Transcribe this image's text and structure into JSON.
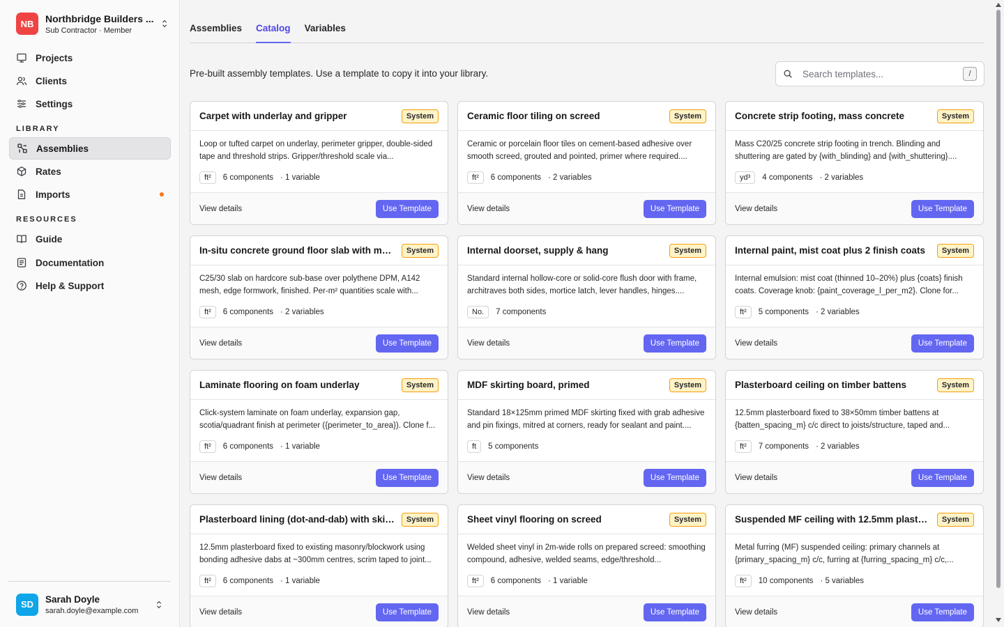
{
  "org": {
    "initials": "NB",
    "name": "Northbridge Builders ...",
    "role": "Sub Contractor · Member"
  },
  "nav": {
    "main": [
      {
        "label": "Projects",
        "icon": "projects-icon"
      },
      {
        "label": "Clients",
        "icon": "users-icon"
      },
      {
        "label": "Settings",
        "icon": "sliders-icon"
      }
    ],
    "library_label": "LIBRARY",
    "library": [
      {
        "label": "Assemblies",
        "icon": "assemblies-icon",
        "active": true
      },
      {
        "label": "Rates",
        "icon": "box-icon"
      },
      {
        "label": "Imports",
        "icon": "file-icon",
        "notification": true
      }
    ],
    "resources_label": "RESOURCES",
    "resources": [
      {
        "label": "Guide",
        "icon": "book-icon"
      },
      {
        "label": "Documentation",
        "icon": "document-icon"
      },
      {
        "label": "Help & Support",
        "icon": "help-icon"
      }
    ]
  },
  "user": {
    "initials": "SD",
    "name": "Sarah Doyle",
    "email": "sarah.doyle@example.com"
  },
  "tabs": [
    {
      "label": "Assemblies",
      "active": false
    },
    {
      "label": "Catalog",
      "active": true
    },
    {
      "label": "Variables",
      "active": false
    }
  ],
  "intro": "Pre-built assembly templates. Use a template to copy it into your library.",
  "search": {
    "placeholder": "Search templates...",
    "shortcut": "/"
  },
  "card_labels": {
    "badge": "System",
    "view": "View details",
    "use": "Use Template"
  },
  "templates": [
    {
      "title": "Carpet with underlay and gripper",
      "desc": "Loop or tufted carpet on underlay, perimeter gripper, double-sided tape and threshold strips. Gripper/threshold scale via...",
      "unit": "ft²",
      "components": "6 components",
      "variables": "· 1 variable"
    },
    {
      "title": "Ceramic floor tiling on screed",
      "desc": "Ceramic or porcelain floor tiles on cement-based adhesive over smooth screed, grouted and pointed, primer where required....",
      "unit": "ft²",
      "components": "6 components",
      "variables": "· 2 variables"
    },
    {
      "title": "Concrete strip footing, mass concrete",
      "desc": "Mass C20/25 concrete strip footing in trench. Blinding and shuttering are gated by {with_blinding} and {with_shuttering}....",
      "unit": "yd³",
      "components": "4 components",
      "variables": "· 2 variables"
    },
    {
      "title": "In-situ concrete ground floor slab with mesh",
      "desc": "C25/30 slab on hardcore sub-base over polythene DPM, A142 mesh, edge formwork, finished. Per-m² quantities scale with...",
      "unit": "ft²",
      "components": "6 components",
      "variables": "· 2 variables"
    },
    {
      "title": "Internal doorset, supply & hang",
      "desc": "Standard internal hollow-core or solid-core flush door with frame, architraves both sides, mortice latch, lever handles, hinges....",
      "unit": "No.",
      "components": "7 components",
      "variables": ""
    },
    {
      "title": "Internal paint, mist coat plus 2 finish coats",
      "desc": "Internal emulsion: mist coat (thinned 10–20%) plus {coats} finish coats. Coverage knob: {paint_coverage_l_per_m2}. Clone for...",
      "unit": "ft²",
      "components": "5 components",
      "variables": "· 2 variables"
    },
    {
      "title": "Laminate flooring on foam underlay",
      "desc": "Click-system laminate on foam underlay, expansion gap, scotia/quadrant finish at perimeter ({perimeter_to_area}). Clone f...",
      "unit": "ft²",
      "components": "6 components",
      "variables": "· 1 variable"
    },
    {
      "title": "MDF skirting board, primed",
      "desc": "Standard 18×125mm primed MDF skirting fixed with grab adhesive and pin fixings, mitred at corners, ready for sealant and paint....",
      "unit": "ft",
      "components": "5 components",
      "variables": ""
    },
    {
      "title": "Plasterboard ceiling on timber battens",
      "desc": "12.5mm plasterboard fixed to 38×50mm timber battens at {batten_spacing_m} c/c direct to joists/structure, taped and...",
      "unit": "ft²",
      "components": "7 components",
      "variables": "· 2 variables"
    },
    {
      "title": "Plasterboard lining (dot-and-dab) with skim ...",
      "desc": "12.5mm plasterboard fixed to existing masonry/blockwork using bonding adhesive dabs at ~300mm centres, scrim taped to joint...",
      "unit": "ft²",
      "components": "6 components",
      "variables": "· 1 variable"
    },
    {
      "title": "Sheet vinyl flooring on screed",
      "desc": "Welded sheet vinyl in 2m-wide rolls on prepared screed: smoothing compound, adhesive, welded seams, edge/threshold...",
      "unit": "ft²",
      "components": "6 components",
      "variables": "· 1 variable"
    },
    {
      "title": "Suspended MF ceiling with 12.5mm plasterb...",
      "desc": "Metal furring (MF) suspended ceiling: primary channels at {primary_spacing_m} c/c, furring at {furring_spacing_m} c/c,...",
      "unit": "ft²",
      "components": "10 components",
      "variables": "· 5 variables"
    }
  ]
}
